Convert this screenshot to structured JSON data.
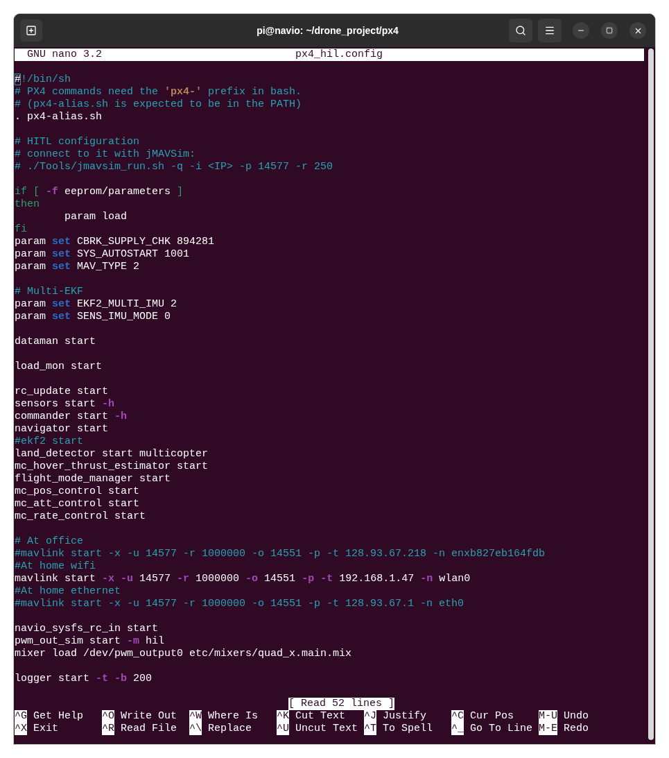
{
  "window": {
    "title": "pi@navio: ~/drone_project/px4"
  },
  "nano": {
    "version": "GNU nano 3.2",
    "filename": "px4_hil.config"
  },
  "lines": [
    {
      "kind": "code",
      "segments": [
        {
          "kind": "cursor",
          "text": "#"
        },
        {
          "kind": "comment",
          "text": "!/bin/sh"
        }
      ]
    },
    {
      "kind": "code",
      "segments": [
        {
          "kind": "comment",
          "text": "# PX4 commands need the "
        },
        {
          "kind": "string",
          "text": "'px4-'"
        },
        {
          "kind": "comment",
          "text": " prefix in bash."
        }
      ]
    },
    {
      "kind": "code",
      "segments": [
        {
          "kind": "comment",
          "text": "# (px4-alias.sh is expected to be in the PATH)"
        }
      ]
    },
    {
      "kind": "code",
      "segments": [
        {
          "kind": "plain",
          "text": ". px4-alias.sh"
        }
      ]
    },
    {
      "kind": "blank"
    },
    {
      "kind": "code",
      "segments": [
        {
          "kind": "comment",
          "text": "# HITL configuration"
        }
      ]
    },
    {
      "kind": "code",
      "segments": [
        {
          "kind": "comment",
          "text": "# connect to it with jMAVSim:"
        }
      ]
    },
    {
      "kind": "code",
      "segments": [
        {
          "kind": "comment",
          "text": "# ./Tools/jmavsim_run.sh -q -i <IP> -p 14577 -r 250"
        }
      ]
    },
    {
      "kind": "blank"
    },
    {
      "kind": "code",
      "segments": [
        {
          "kind": "keyword",
          "text": "if [ "
        },
        {
          "kind": "flag",
          "text": "-f"
        },
        {
          "kind": "plain",
          "text": " eeprom/parameters "
        },
        {
          "kind": "keyword",
          "text": "]"
        }
      ]
    },
    {
      "kind": "code",
      "segments": [
        {
          "kind": "keyword",
          "text": "then"
        }
      ]
    },
    {
      "kind": "code",
      "segments": [
        {
          "kind": "plain",
          "text": "        param load"
        }
      ]
    },
    {
      "kind": "code",
      "segments": [
        {
          "kind": "keyword",
          "text": "fi"
        }
      ]
    },
    {
      "kind": "code",
      "segments": [
        {
          "kind": "plain",
          "text": "param "
        },
        {
          "kind": "builtin",
          "text": "set"
        },
        {
          "kind": "plain",
          "text": " CBRK_SUPPLY_CHK 894281"
        }
      ]
    },
    {
      "kind": "code",
      "segments": [
        {
          "kind": "plain",
          "text": "param "
        },
        {
          "kind": "builtin",
          "text": "set"
        },
        {
          "kind": "plain",
          "text": " SYS_AUTOSTART 1001"
        }
      ]
    },
    {
      "kind": "code",
      "segments": [
        {
          "kind": "plain",
          "text": "param "
        },
        {
          "kind": "builtin",
          "text": "set"
        },
        {
          "kind": "plain",
          "text": " MAV_TYPE 2"
        }
      ]
    },
    {
      "kind": "blank"
    },
    {
      "kind": "code",
      "segments": [
        {
          "kind": "comment",
          "text": "# Multi-EKF"
        }
      ]
    },
    {
      "kind": "code",
      "segments": [
        {
          "kind": "plain",
          "text": "param "
        },
        {
          "kind": "builtin",
          "text": "set"
        },
        {
          "kind": "plain",
          "text": " EKF2_MULTI_IMU 2"
        }
      ]
    },
    {
      "kind": "code",
      "segments": [
        {
          "kind": "plain",
          "text": "param "
        },
        {
          "kind": "builtin",
          "text": "set"
        },
        {
          "kind": "plain",
          "text": " SENS_IMU_MODE 0"
        }
      ]
    },
    {
      "kind": "blank"
    },
    {
      "kind": "code",
      "segments": [
        {
          "kind": "plain",
          "text": "dataman start"
        }
      ]
    },
    {
      "kind": "blank"
    },
    {
      "kind": "code",
      "segments": [
        {
          "kind": "plain",
          "text": "load_mon start"
        }
      ]
    },
    {
      "kind": "blank"
    },
    {
      "kind": "code",
      "segments": [
        {
          "kind": "plain",
          "text": "rc_update start"
        }
      ]
    },
    {
      "kind": "code",
      "segments": [
        {
          "kind": "plain",
          "text": "sensors start "
        },
        {
          "kind": "flag",
          "text": "-h"
        }
      ]
    },
    {
      "kind": "code",
      "segments": [
        {
          "kind": "plain",
          "text": "commander start "
        },
        {
          "kind": "flag",
          "text": "-h"
        }
      ]
    },
    {
      "kind": "code",
      "segments": [
        {
          "kind": "plain",
          "text": "navigator start"
        }
      ]
    },
    {
      "kind": "code",
      "segments": [
        {
          "kind": "comment",
          "text": "#ekf2 start"
        }
      ]
    },
    {
      "kind": "code",
      "segments": [
        {
          "kind": "plain",
          "text": "land_detector start multicopter"
        }
      ]
    },
    {
      "kind": "code",
      "segments": [
        {
          "kind": "plain",
          "text": "mc_hover_thrust_estimator start"
        }
      ]
    },
    {
      "kind": "code",
      "segments": [
        {
          "kind": "plain",
          "text": "flight_mode_manager start"
        }
      ]
    },
    {
      "kind": "code",
      "segments": [
        {
          "kind": "plain",
          "text": "mc_pos_control start"
        }
      ]
    },
    {
      "kind": "code",
      "segments": [
        {
          "kind": "plain",
          "text": "mc_att_control start"
        }
      ]
    },
    {
      "kind": "code",
      "segments": [
        {
          "kind": "plain",
          "text": "mc_rate_control start"
        }
      ]
    },
    {
      "kind": "blank"
    },
    {
      "kind": "code",
      "segments": [
        {
          "kind": "comment",
          "text": "# At office"
        }
      ]
    },
    {
      "kind": "code",
      "segments": [
        {
          "kind": "comment",
          "text": "#mavlink start -x -u 14577 -r 1000000 -o 14551 -p -t 128.93.67.218 -n enxb827eb164fdb"
        }
      ]
    },
    {
      "kind": "code",
      "segments": [
        {
          "kind": "comment",
          "text": "#At home wifi"
        }
      ]
    },
    {
      "kind": "code",
      "segments": [
        {
          "kind": "plain",
          "text": "mavlink start "
        },
        {
          "kind": "flag",
          "text": "-x -u"
        },
        {
          "kind": "plain",
          "text": " 14577 "
        },
        {
          "kind": "flag",
          "text": "-r"
        },
        {
          "kind": "plain",
          "text": " 1000000 "
        },
        {
          "kind": "flag",
          "text": "-o"
        },
        {
          "kind": "plain",
          "text": " 14551 "
        },
        {
          "kind": "flag",
          "text": "-p -t"
        },
        {
          "kind": "plain",
          "text": " 192.168.1.47 "
        },
        {
          "kind": "flag",
          "text": "-n"
        },
        {
          "kind": "plain",
          "text": " wlan0"
        }
      ]
    },
    {
      "kind": "code",
      "segments": [
        {
          "kind": "comment",
          "text": "#At home ethernet"
        }
      ]
    },
    {
      "kind": "code",
      "segments": [
        {
          "kind": "comment",
          "text": "#mavlink start -x -u 14577 -r 1000000 -o 14551 -p -t 128.93.67.1 -n eth0"
        }
      ]
    },
    {
      "kind": "blank"
    },
    {
      "kind": "code",
      "segments": [
        {
          "kind": "plain",
          "text": "navio_sysfs_rc_in start"
        }
      ]
    },
    {
      "kind": "code",
      "segments": [
        {
          "kind": "plain",
          "text": "pwm_out_sim start "
        },
        {
          "kind": "flag",
          "text": "-m"
        },
        {
          "kind": "plain",
          "text": " hil"
        }
      ]
    },
    {
      "kind": "code",
      "segments": [
        {
          "kind": "plain",
          "text": "mixer load /dev/pwm_output0 etc/mixers/quad_x.main.mix"
        }
      ]
    },
    {
      "kind": "blank"
    },
    {
      "kind": "code",
      "segments": [
        {
          "kind": "plain",
          "text": "logger start "
        },
        {
          "kind": "flag",
          "text": "-t -b"
        },
        {
          "kind": "plain",
          "text": " 200"
        }
      ]
    }
  ],
  "status": "[ Read 52 lines ]",
  "shortcuts": [
    {
      "key": "^G",
      "label": "Get Help"
    },
    {
      "key": "^O",
      "label": "Write Out"
    },
    {
      "key": "^W",
      "label": "Where Is"
    },
    {
      "key": "^K",
      "label": "Cut Text"
    },
    {
      "key": "^J",
      "label": "Justify"
    },
    {
      "key": "^C",
      "label": "Cur Pos"
    },
    {
      "key": "M-U",
      "label": "Undo"
    },
    {
      "key": "^X",
      "label": "Exit"
    },
    {
      "key": "^R",
      "label": "Read File"
    },
    {
      "key": "^\\",
      "label": "Replace"
    },
    {
      "key": "^U",
      "label": "Uncut Text"
    },
    {
      "key": "^T",
      "label": "To Spell"
    },
    {
      "key": "^_",
      "label": "Go To Line"
    },
    {
      "key": "M-E",
      "label": "Redo"
    }
  ]
}
